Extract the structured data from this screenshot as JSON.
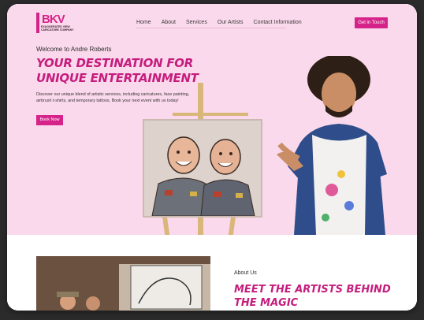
{
  "brand": {
    "logo_text": "BKV",
    "logo_sub": "EXAGGERATED VIEW CARICATURE COMPANY"
  },
  "nav": {
    "items": [
      "Home",
      "About",
      "Services",
      "Our Artists",
      "Contact Information"
    ],
    "cta": "Get in Touch"
  },
  "hero": {
    "welcome": "Welcome to Andre Roberts",
    "headline": "Your Destination for Unique Entertainment",
    "description": "Discover our unique blend of artistic services, including caricatures, face painting, airbrush t-shirts, and temporary tattoos. Book your next event with us today!",
    "button": "Book Now"
  },
  "about": {
    "label": "About Us",
    "title": "Meet the Artists Behind the Magic"
  },
  "colors": {
    "accent": "#d6238a",
    "hero_bg": "#fbd9ec"
  }
}
